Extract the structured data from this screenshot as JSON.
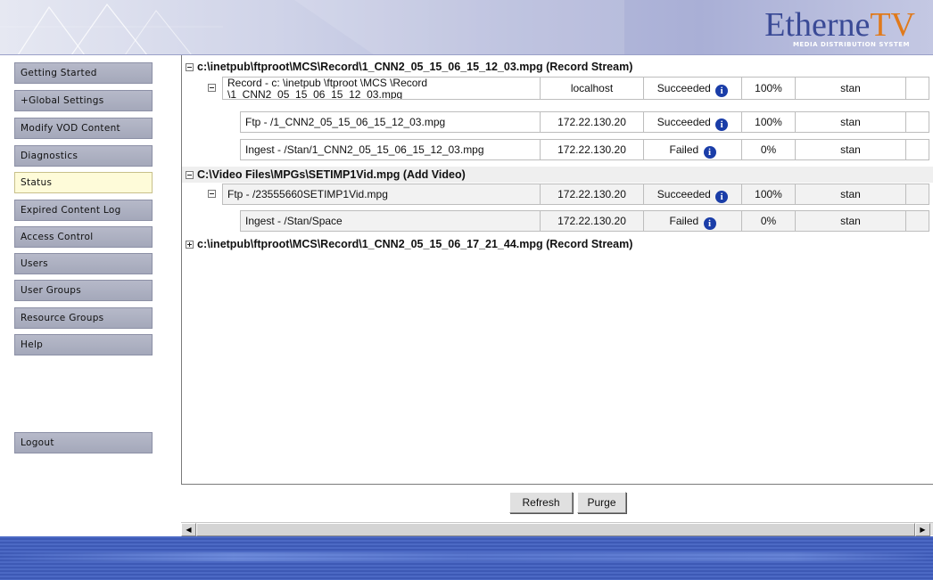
{
  "brand": {
    "logo_text_main": "Etherne",
    "logo_text_tv": "TV",
    "logo_tagline": "MEDIA DISTRIBUTION SYSTEM",
    "colors": {
      "logo_blue": "#3a4a96",
      "logo_orange": "#e07a1c",
      "footer_blue": "#4c69c4"
    }
  },
  "sidebar": {
    "items": [
      {
        "label": "Getting Started"
      },
      {
        "label": "+Global Settings"
      },
      {
        "label": "Modify VOD Content"
      },
      {
        "label": "Diagnostics"
      },
      {
        "label": "Status",
        "active": true
      },
      {
        "label": "Expired Content Log"
      },
      {
        "label": "Access Control"
      },
      {
        "label": "Users"
      },
      {
        "label": "User Groups"
      },
      {
        "label": "Resource Groups"
      },
      {
        "label": "Help"
      }
    ],
    "logout_label": "Logout"
  },
  "status": {
    "groups": [
      {
        "title": "c:\\inetpub\\ftproot\\MCS\\Record\\1_CNN2_05_15_06_15_12_03.mpg (Record Stream)",
        "expanded": true,
        "jobs": [
          {
            "name_line1": "Record - c: \\inetpub \\ftproot \\MCS \\Record",
            "name_line2": "\\1_CNN2_05_15_06_15_12_03.mpg",
            "host": "localhost",
            "status": "Succeeded",
            "progress": "100%",
            "user": "stan",
            "expandable": true
          },
          {
            "name_line1": "Ftp - /1_CNN2_05_15_06_15_12_03.mpg",
            "host": "172.22.130.20",
            "status": "Succeeded",
            "progress": "100%",
            "user": "stan"
          },
          {
            "name_line1": "Ingest - /Stan/1_CNN2_05_15_06_15_12_03.mpg",
            "host": "172.22.130.20",
            "status": "Failed",
            "progress": "0%",
            "user": "stan"
          }
        ]
      },
      {
        "title": "C:\\Video Files\\MPGs\\SETIMP1Vid.mpg (Add Video)",
        "expanded": true,
        "jobs": [
          {
            "name_line1": "Ftp - /23555660SETIMP1Vid.mpg",
            "host": "172.22.130.20",
            "status": "Succeeded",
            "progress": "100%",
            "user": "stan",
            "expandable": true
          },
          {
            "name_line1": "Ingest - /Stan/Space",
            "host": "172.22.130.20",
            "status": "Failed",
            "progress": "0%",
            "user": "stan"
          }
        ]
      },
      {
        "title": "c:\\inetpub\\ftproot\\MCS\\Record\\1_CNN2_05_15_06_17_21_44.mpg (Record Stream)",
        "expanded": false,
        "jobs": []
      }
    ],
    "info_icon": "info-icon"
  },
  "actions": {
    "refresh_label": "Refresh",
    "purge_label": "Purge"
  },
  "scrollbar": {
    "left_arrow": "◀",
    "right_arrow": "▶"
  }
}
